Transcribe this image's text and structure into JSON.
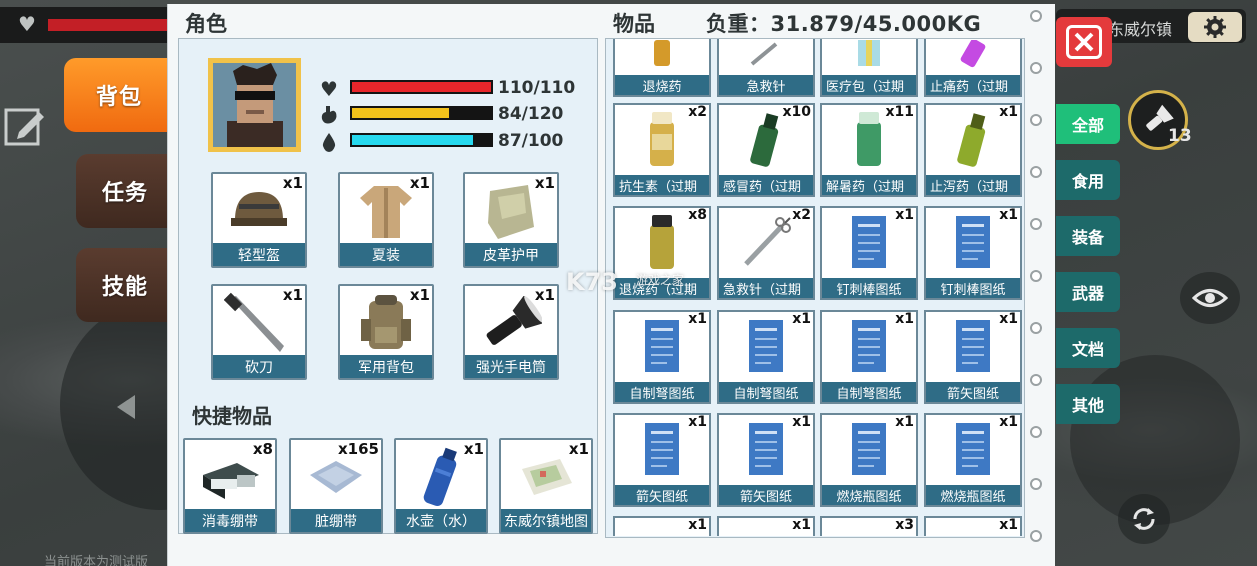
{
  "hud": {
    "town_name": "东威尔镇",
    "torch_count": "13"
  },
  "tabs": {
    "backpack": "背包",
    "quests": "任务",
    "skills": "技能"
  },
  "character": {
    "title": "角色",
    "stats": {
      "health": {
        "text": "110/110",
        "value": 110,
        "max": 110,
        "color": "#e8262b"
      },
      "hunger": {
        "text": "84/120",
        "value": 84,
        "max": 120,
        "color": "#f3c21b"
      },
      "thirst": {
        "text": "87/100",
        "value": 87,
        "max": 100,
        "color": "#27d9ef"
      }
    },
    "equipment": [
      {
        "label": "轻型盔",
        "count": "x1",
        "icon": "helmet-icon"
      },
      {
        "label": "夏装",
        "count": "x1",
        "icon": "summer-clothes-icon"
      },
      {
        "label": "皮革护甲",
        "count": "x1",
        "icon": "leather-armor-icon"
      },
      {
        "label": "砍刀",
        "count": "x1",
        "icon": "machete-icon"
      },
      {
        "label": "军用背包",
        "count": "x1",
        "icon": "military-backpack-icon"
      },
      {
        "label": "强光手电筒",
        "count": "x1",
        "icon": "flashlight-icon"
      }
    ]
  },
  "quick_items": {
    "title": "快捷物品",
    "items": [
      {
        "label": "消毒绷带",
        "count": "x8",
        "icon": "disinfected-bandage-icon"
      },
      {
        "label": "脏绷带",
        "count": "x165",
        "icon": "dirty-bandage-icon"
      },
      {
        "label": "水壶（水）",
        "count": "x1",
        "icon": "water-bottle-icon"
      },
      {
        "label": "东威尔镇地图",
        "count": "x1",
        "icon": "town-map-icon"
      }
    ]
  },
  "inventory": {
    "title": "物品",
    "weight": "负重：31.879/45.000KG",
    "top_row": [
      {
        "label": "退烧药",
        "icon": "fever-medicine-icon"
      },
      {
        "label": "急救针",
        "icon": "first-aid-syringe-icon"
      },
      {
        "label": "医疗包（过期",
        "icon": "medical-kit-icon"
      },
      {
        "label": "止痛药（过期",
        "icon": "painkiller-icon"
      }
    ],
    "rows": [
      [
        {
          "label": "抗生素（过期",
          "count": "x2",
          "icon": "antibiotics-icon"
        },
        {
          "label": "感冒药（过期",
          "count": "x10",
          "icon": "cold-medicine-icon"
        },
        {
          "label": "解暑药（过期",
          "count": "x11",
          "icon": "heatstroke-medicine-icon"
        },
        {
          "label": "止泻药（过期",
          "count": "x1",
          "icon": "antidiarrheal-icon"
        }
      ],
      [
        {
          "label": "退烧药（过期",
          "count": "x8",
          "icon": "fever-medicine-icon"
        },
        {
          "label": "急救针（过期",
          "count": "x2",
          "icon": "first-aid-syringe-icon"
        },
        {
          "label": "钉刺棒图纸",
          "count": "x1",
          "icon": "blueprint-icon"
        },
        {
          "label": "钉刺棒图纸",
          "count": "x1",
          "icon": "blueprint-icon"
        }
      ],
      [
        {
          "label": "自制弩图纸",
          "count": "x1",
          "icon": "blueprint-icon"
        },
        {
          "label": "自制弩图纸",
          "count": "x1",
          "icon": "blueprint-icon"
        },
        {
          "label": "自制弩图纸",
          "count": "x1",
          "icon": "blueprint-icon"
        },
        {
          "label": "箭矢图纸",
          "count": "x1",
          "icon": "blueprint-icon"
        }
      ],
      [
        {
          "label": "箭矢图纸",
          "count": "x1",
          "icon": "blueprint-icon"
        },
        {
          "label": "箭矢图纸",
          "count": "x1",
          "icon": "blueprint-icon"
        },
        {
          "label": "燃烧瓶图纸",
          "count": "x1",
          "icon": "blueprint-icon"
        },
        {
          "label": "燃烧瓶图纸",
          "count": "x1",
          "icon": "blueprint-icon"
        }
      ]
    ],
    "bottom_row_counts": [
      "x1",
      "x1",
      "x3",
      "x1"
    ]
  },
  "categories": [
    "全部",
    "食用",
    "装备",
    "武器",
    "文档",
    "其他"
  ],
  "watermark": {
    "main": "K73",
    "sub": "游戏之家"
  },
  "colors": {
    "accent_orange": "#f27a18",
    "label_blue": "#2f6c86",
    "category_active": "#1fbf7a",
    "category_inactive": "#1d6a6a",
    "close_red": "#e43a3c"
  }
}
